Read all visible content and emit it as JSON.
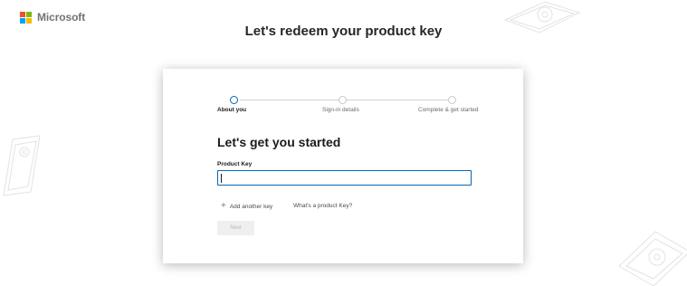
{
  "brand": {
    "name": "Microsoft",
    "logo_colors": [
      "#f25022",
      "#7fba00",
      "#00a4ef",
      "#ffb900"
    ]
  },
  "page": {
    "title": "Let's redeem your product key"
  },
  "stepper": {
    "steps": [
      {
        "label": "About you",
        "state": "active"
      },
      {
        "label": "Sign-in details",
        "state": "pending"
      },
      {
        "label": "Complete & get started",
        "state": "pending"
      }
    ]
  },
  "form": {
    "heading": "Let's get you started",
    "product_key_label": "Product Key",
    "product_key_value": "",
    "add_key_label": "Add another key",
    "whats_key_link": "What's a product Key?",
    "next_label": "Next"
  },
  "colors": {
    "accent": "#0067b8",
    "disabled_button": "#efefef"
  }
}
